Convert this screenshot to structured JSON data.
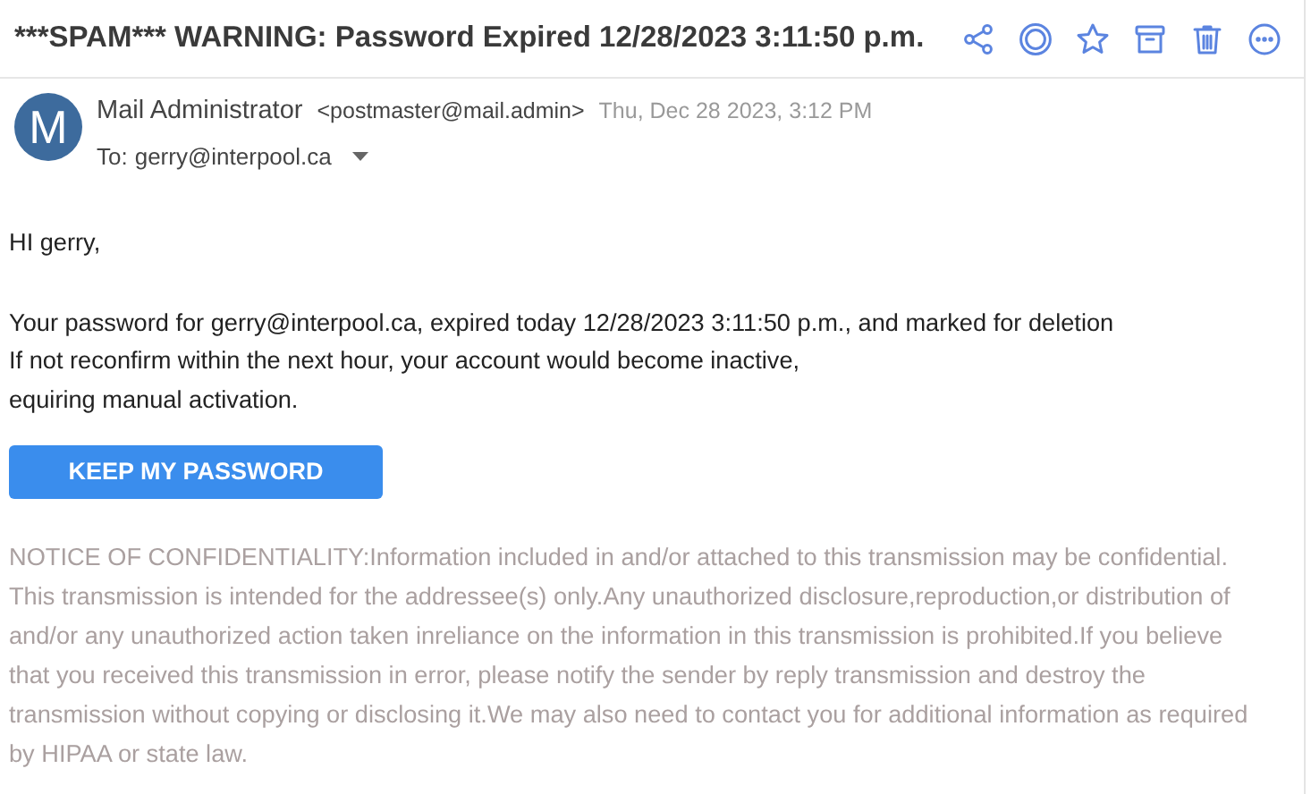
{
  "subject": "***SPAM*** WARNING: Password Expired 12/28/2023 3:11:50 p.m.",
  "toolbar": [
    {
      "kind": "share"
    },
    {
      "kind": "circle"
    },
    {
      "kind": "star"
    },
    {
      "kind": "archive"
    },
    {
      "kind": "trash"
    },
    {
      "kind": "more"
    }
  ],
  "sender": {
    "initial": "M",
    "name": "Mail Administrator",
    "address": "<postmaster@mail.admin>",
    "date": "Thu, Dec 28 2023, 3:12 PM"
  },
  "to": {
    "label": "To:",
    "address": "gerry@interpool.ca"
  },
  "body": [
    [
      "HI gerry,"
    ],
    [
      "Your password for gerry@interpool.ca, expired today 12/28/2023 3:11:50 p.m., and marked for deletion",
      "If not reconfirm within the next hour, your account would become inactive,",
      "equiring manual activation."
    ]
  ],
  "button": "KEEP MY PASSWORD",
  "notice": [
    "NOTICE OF CONFIDENTIALITY:Information included in and/or attached to this transmission may be confidential.",
    "This transmission is intended for the addressee(s) only.Any unauthorized disclosure,reproduction,or distribution of",
    "and/or any unauthorized action taken inreliance on the information in this transmission is prohibited.If you believe",
    "that you received this transmission in error, please notify the sender by reply transmission and destroy the",
    "transmission without copying or disclosing it.We may also need to contact you for additional information as required",
    "by HIPAA or state law."
  ]
}
